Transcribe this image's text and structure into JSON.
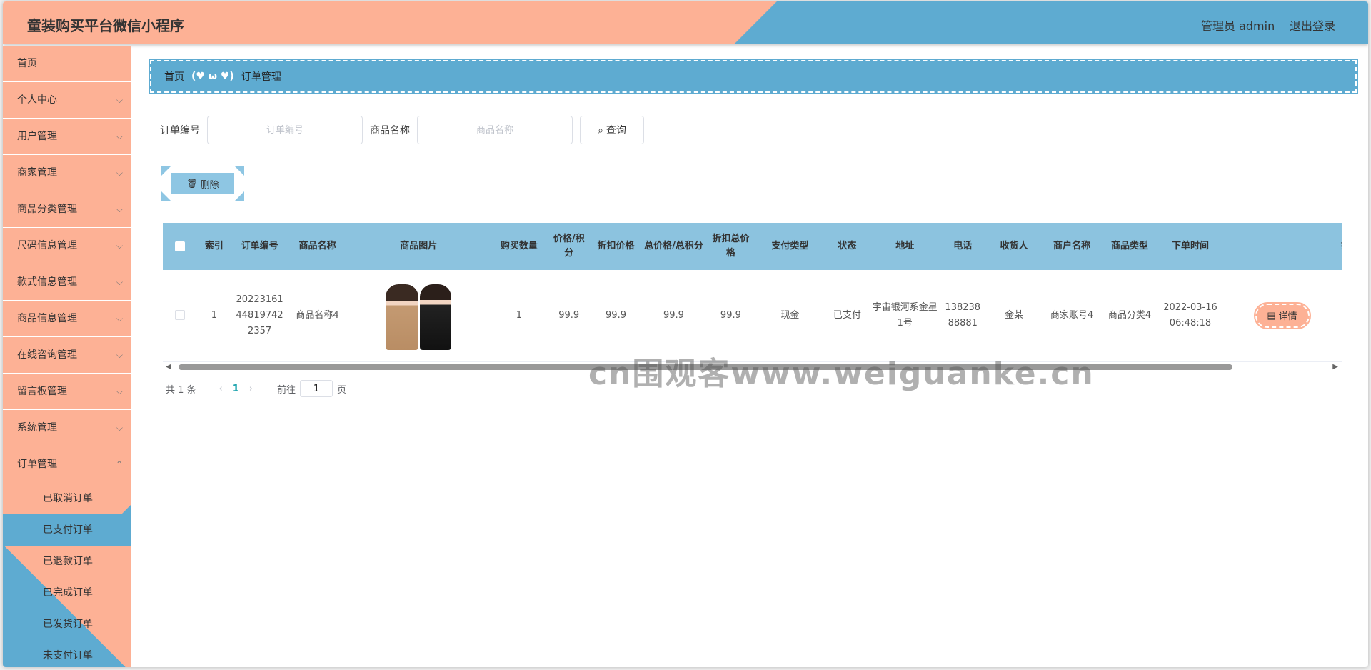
{
  "header": {
    "title": "童装购买平台微信小程序",
    "admin_label": "管理员 admin",
    "logout_label": "退出登录"
  },
  "sidebar": {
    "items": [
      {
        "label": "首页",
        "has_children": false
      },
      {
        "label": "个人中心",
        "has_children": true
      },
      {
        "label": "用户管理",
        "has_children": true
      },
      {
        "label": "商家管理",
        "has_children": true
      },
      {
        "label": "商品分类管理",
        "has_children": true
      },
      {
        "label": "尺码信息管理",
        "has_children": true
      },
      {
        "label": "款式信息管理",
        "has_children": true
      },
      {
        "label": "商品信息管理",
        "has_children": true
      },
      {
        "label": "在线咨询管理",
        "has_children": true
      },
      {
        "label": "留言板管理",
        "has_children": true
      },
      {
        "label": "系统管理",
        "has_children": true
      },
      {
        "label": "订单管理",
        "has_children": true,
        "expanded": true
      }
    ],
    "submenu": [
      "已取消订单",
      "已支付订单",
      "已退款订单",
      "已完成订单",
      "已发货订单",
      "未支付订单"
    ],
    "active_sub": "已支付订单",
    "chevron_down": "⌵",
    "chevron_up": "⌃"
  },
  "breadcrumb": {
    "home": "首页",
    "separator": "(♥ ω ♥)",
    "current": "订单管理"
  },
  "search": {
    "order_no_label": "订单编号",
    "order_no_placeholder": "订单编号",
    "product_name_label": "商品名称",
    "product_name_placeholder": "商品名称",
    "query_button": "查询",
    "search_icon": "⌕"
  },
  "actions": {
    "delete_button": "删除",
    "delete_icon": "🗑"
  },
  "table": {
    "columns": [
      "索引",
      "订单编号",
      "商品名称",
      "商品图片",
      "购买数量",
      "价格/积分",
      "折扣价格",
      "总价格/总积分",
      "折扣总价格",
      "支付类型",
      "状态",
      "地址",
      "电话",
      "收货人",
      "商户名称",
      "商品类型",
      "下单时间",
      "操作"
    ],
    "rows": [
      {
        "index": "1",
        "order_no": "20223161448197422357",
        "product_name": "商品名称4",
        "quantity": "1",
        "price": "99.9",
        "discount_price": "99.9",
        "total_price": "99.9",
        "discount_total": "99.9",
        "pay_type": "现金",
        "status": "已支付",
        "address": "宇宙银河系金星1号",
        "phone": "13823888881",
        "receiver": "金某",
        "merchant": "商家账号4",
        "product_type": "商品分类4",
        "order_time": "2022-03-16 06:48:18",
        "detail_button": "详情",
        "detail_icon": "▤"
      }
    ]
  },
  "pagination": {
    "total": "共 1 条",
    "prev": "‹",
    "current_page": "1",
    "next": "›",
    "goto_label": "前往",
    "goto_value": "1",
    "page_suffix": "页"
  },
  "watermark": "cn围观客www.weiguanke.cn",
  "colors": {
    "peach": "#fdb195",
    "blue": "#5eabd1",
    "table_header": "#8cc3df"
  }
}
